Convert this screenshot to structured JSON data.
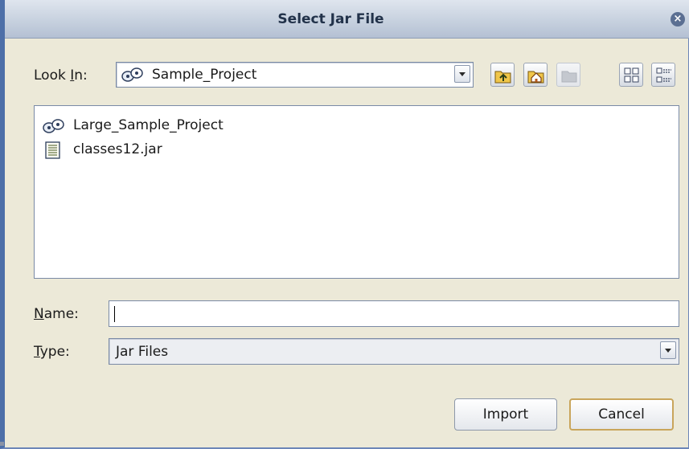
{
  "dialog": {
    "title": "Select Jar File",
    "close_icon": "close-icon"
  },
  "look_in": {
    "label_prefix": "Look ",
    "label_mnemonic": "I",
    "label_suffix": "n:",
    "value": "Sample_Project",
    "value_icon": "project-icon"
  },
  "toolbar": [
    {
      "name": "up-one-level-icon"
    },
    {
      "name": "home-icon"
    },
    {
      "name": "new-folder-icon"
    },
    {
      "name": "list-view-icon"
    },
    {
      "name": "details-view-icon"
    }
  ],
  "files": [
    {
      "name": "Large_Sample_Project",
      "icon": "project-icon"
    },
    {
      "name": "classes12.jar",
      "icon": "jar-file-icon"
    }
  ],
  "name_field": {
    "label_mnemonic": "N",
    "label_suffix": "ame:",
    "value": ""
  },
  "type_field": {
    "label_mnemonic": "T",
    "label_suffix": "ype:",
    "value": "Jar Files"
  },
  "buttons": {
    "import_label": "Import",
    "cancel_label": "Cancel"
  },
  "colors": {
    "window_bg": "#ece9d8",
    "title_text": "#22324a",
    "frame_border": "#4d6fa8",
    "default_button_border": "#c9a55b"
  }
}
